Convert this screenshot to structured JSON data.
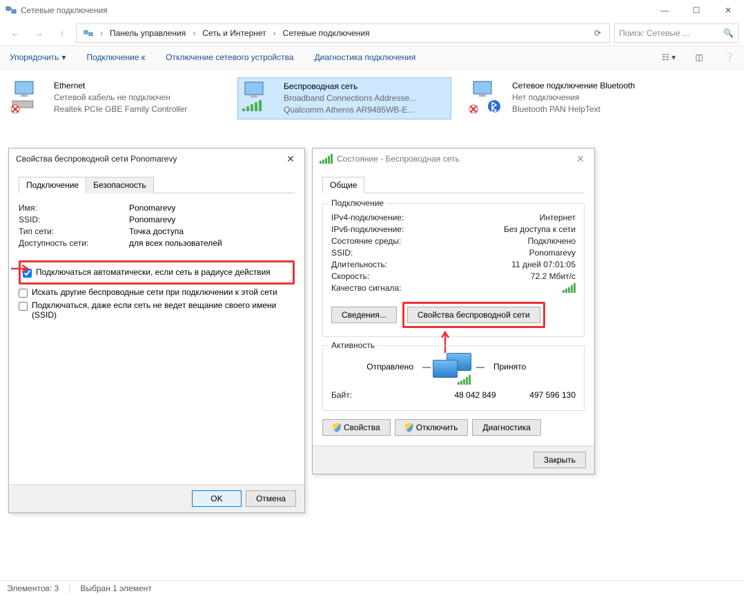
{
  "window": {
    "title": "Сетевые подключения",
    "search_placeholder": "Поиск: Сетевые ..."
  },
  "breadcrumb": {
    "segments": [
      "Панель управления",
      "Сеть и Интернет",
      "Сетевые подключения"
    ]
  },
  "toolbar": {
    "organize": "Упорядочить",
    "connect": "Подключение к",
    "disable": "Отключение сетевого устройства",
    "diagnose": "Диагностика подключения"
  },
  "items": [
    {
      "name": "Ethernet",
      "status": "Сетевой кабель не подключен",
      "adapter": "Realtek PCIe GBE Family Controller"
    },
    {
      "name": "Беспроводная сеть",
      "status": "Broadband Connections Addresse...",
      "adapter": "Qualcomm Atheros AR9485WB-E..."
    },
    {
      "name": "Сетевое подключение Bluetooth",
      "status": "Нет подключения",
      "adapter": "Bluetooth PAN HelpText"
    }
  ],
  "props_dialog": {
    "title": "Свойства беспроводной сети Ponomarevy",
    "tabs": {
      "connection": "Подключение",
      "security": "Безопасность"
    },
    "fields": {
      "name_label": "Имя:",
      "name_value": "Ponomarevy",
      "ssid_label": "SSID:",
      "ssid_value": "Ponomarevy",
      "type_label": "Тип сети:",
      "type_value": "Точка доступа",
      "avail_label": "Доступность сети:",
      "avail_value": "для всех пользователей"
    },
    "checks": {
      "auto": "Подключаться автоматически, если сеть в радиусе действия",
      "lookup": "Искать другие беспроводные сети при подключении к этой сети",
      "hidden": "Подключаться, даже если сеть не ведет вещание своего имени (SSID)"
    },
    "buttons": {
      "ok": "OK",
      "cancel": "Отмена"
    }
  },
  "status_dialog": {
    "title": "Состояние - Беспроводная сеть",
    "tab": "Общие",
    "conn_group": "Подключение",
    "rows": {
      "ipv4_l": "IPv4-подключение:",
      "ipv4_v": "Интернет",
      "ipv6_l": "IPv6-подключение:",
      "ipv6_v": "Без доступа к сети",
      "media_l": "Состояние среды:",
      "media_v": "Подключено",
      "ssid_l": "SSID:",
      "ssid_v": "Ponomarevy",
      "dur_l": "Длительность:",
      "dur_v": "11 дней 07:01:05",
      "speed_l": "Скорость:",
      "speed_v": "72.2 Мбит/с",
      "signal_l": "Качество сигнала:"
    },
    "buttons": {
      "details": "Сведения...",
      "wifi_props": "Свойства беспроводной сети",
      "props": "Свойства",
      "disable": "Отключить",
      "diagnose": "Диагностика",
      "close": "Закрыть"
    },
    "activity": {
      "group": "Активность",
      "sent_l": "Отправлено",
      "recv_l": "Принято",
      "bytes_l": "Байт:",
      "sent_v": "48 042 849",
      "recv_v": "497 596 130"
    }
  },
  "statusbar": {
    "count": "Элементов: 3",
    "selected": "Выбран 1 элемент"
  }
}
